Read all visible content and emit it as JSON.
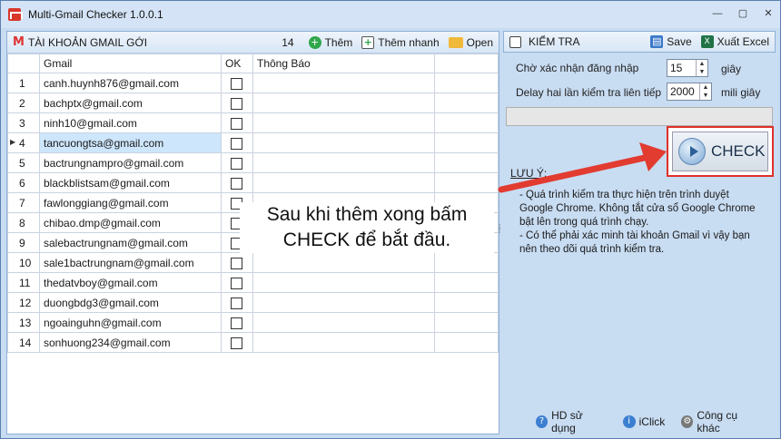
{
  "window": {
    "title": "Multi-Gmail Checker  1.0.0.1"
  },
  "left": {
    "header_title": "TÀI KHOẢN GMAIL GỚI",
    "count": "14",
    "btn_add": "Thêm",
    "btn_add_quick": "Thêm nhanh",
    "btn_open": "Open"
  },
  "grid": {
    "col_gmail": "Gmail",
    "col_ok": "OK",
    "col_notice": "Thông Báo",
    "rows": [
      {
        "n": "1",
        "email": "canh.huynh876@gmail.com"
      },
      {
        "n": "2",
        "email": "bachptx@gmail.com"
      },
      {
        "n": "3",
        "email": "ninh10@gmail.com"
      },
      {
        "n": "4",
        "email": "tancuongtsa@gmail.com"
      },
      {
        "n": "5",
        "email": "bactrungnampro@gmail.com"
      },
      {
        "n": "6",
        "email": "blackblistsam@gmail.com"
      },
      {
        "n": "7",
        "email": "fawlonggiang@gmail.com"
      },
      {
        "n": "8",
        "email": "chibao.dmp@gmail.com"
      },
      {
        "n": "9",
        "email": "salebactrungnam@gmail.com"
      },
      {
        "n": "10",
        "email": "sale1bactrungnam@gmail.com"
      },
      {
        "n": "11",
        "email": "thedatvboy@gmail.com"
      },
      {
        "n": "12",
        "email": "duongbdg3@gmail.com"
      },
      {
        "n": "13",
        "email": "ngoainguhn@gmail.com"
      },
      {
        "n": "14",
        "email": "sonhuong234@gmail.com"
      }
    ]
  },
  "overlay": {
    "line1": "Sau khi thêm xong bấm",
    "line2": "CHECK để bắt đầu."
  },
  "right": {
    "header_title": "KIỂM TRA",
    "btn_save": "Save",
    "btn_excel": "Xuất Excel",
    "wait_label": "Chờ xác nhận đăng nhập",
    "wait_value": "15",
    "wait_unit": "giây",
    "delay_label": "Delay hai lần kiểm tra liên tiếp",
    "delay_value": "2000",
    "delay_unit": "mili giây",
    "check_label": "CHECK",
    "note_title": "LƯU Ý:",
    "note_1a": "- Quá trình kiểm tra thực hiện trên trình duyệt",
    "note_1b": "Google Chrome. Không tắt cửa sổ Google Chrome",
    "note_1c": "bật lên trong quá trình chạy.",
    "note_2a": "- Có thể phải xác minh tài khoản Gmail vì vậy bạn",
    "note_2b": "nên theo dõi quá trình kiểm tra."
  },
  "footer": {
    "help": "HD sử dụng",
    "iclick": "iClick",
    "tools": "Công cụ khác"
  }
}
